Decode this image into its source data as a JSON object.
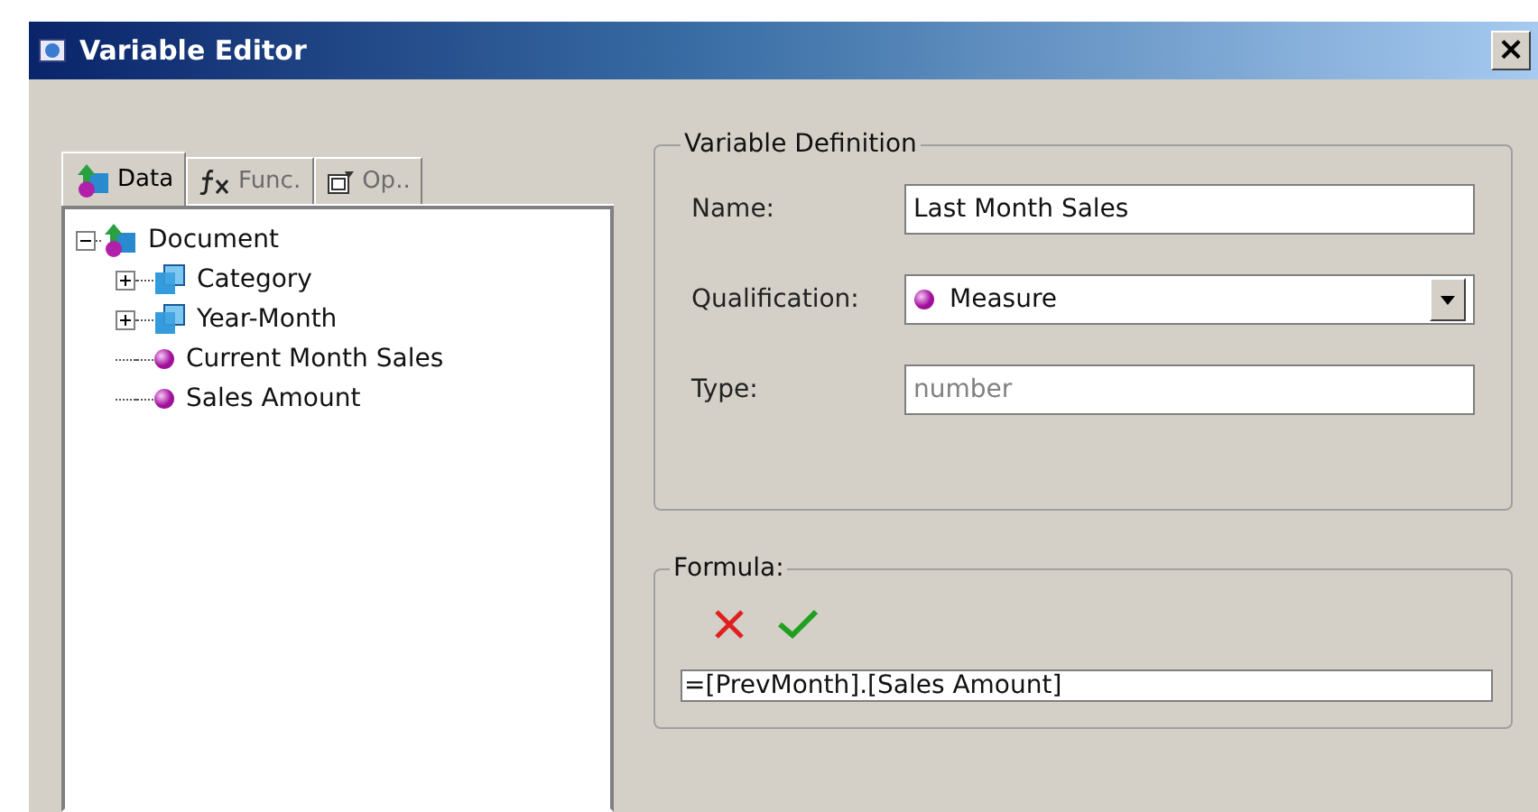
{
  "window": {
    "title": "Variable Editor",
    "close": "×"
  },
  "tabs": [
    {
      "label": "Data",
      "kind": "data",
      "selected": true
    },
    {
      "label": "Func.",
      "kind": "function",
      "selected": false
    },
    {
      "label": "Op..",
      "kind": "operator",
      "selected": false
    }
  ],
  "tree": [
    {
      "label": "Document",
      "kind": "document",
      "expanded": true,
      "children": [
        {
          "label": "Category",
          "kind": "dimension",
          "expanded": false
        },
        {
          "label": "Year-Month",
          "kind": "dimension",
          "expanded": false
        },
        {
          "label": "Current Month Sales",
          "kind": "measure"
        },
        {
          "label": "Sales Amount",
          "kind": "measure"
        }
      ]
    }
  ],
  "definition": {
    "legend": "Variable Definition",
    "fields": [
      {
        "label": "Name:",
        "kind": "text",
        "value": "Last Month Sales"
      },
      {
        "label": "Qualification:",
        "kind": "select",
        "value": "Measure"
      },
      {
        "label": "Type:",
        "kind": "readonly",
        "value": "number"
      }
    ]
  },
  "formula": {
    "legend": "Formula:",
    "value": "=[PrevMonth].[Sales Amount]"
  }
}
